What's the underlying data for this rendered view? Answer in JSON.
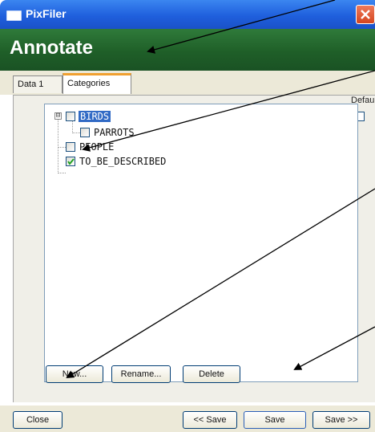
{
  "window": {
    "title": "PixFiler"
  },
  "header": {
    "title": "Annotate"
  },
  "tabs": [
    {
      "label": "Data 1"
    },
    {
      "label": "Categories"
    }
  ],
  "tree": {
    "items": [
      {
        "label": "BIRDS",
        "checked": false,
        "expanded": true,
        "selected": true
      },
      {
        "label": "PARROTS",
        "checked": false
      },
      {
        "label": "PEOPLE",
        "checked": false
      },
      {
        "label": "TO_BE_DESCRIBED",
        "checked": true
      }
    ],
    "expander_symbol": "⊟"
  },
  "default": {
    "label": "Default",
    "checked": false
  },
  "buttons": {
    "new": "New...",
    "rename": "Rename...",
    "delete": "Delete",
    "close": "Close",
    "save_prev": "<< Save",
    "save": "Save",
    "save_next": "Save >>"
  },
  "colors": {
    "title_bar": "#1f5fdd",
    "header_band": "#1f5f28",
    "selection": "#316ac5",
    "annotation_arrows": "#000000"
  }
}
